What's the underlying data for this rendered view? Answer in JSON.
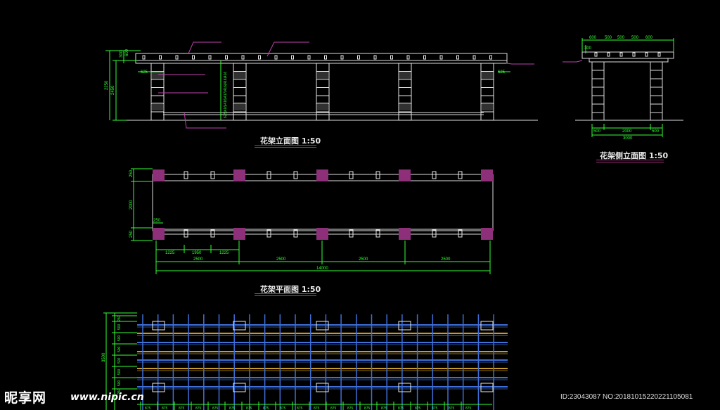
{
  "titles": {
    "front": "花架立面图   1:50",
    "side": "花架侧立面图   1:50",
    "plan": "花架平面图   1:50"
  },
  "front_dims": {
    "left_vertical": [
      "2250",
      "2450",
      "300",
      "600",
      "625"
    ],
    "pillar_stack": "625|416|416|417|416|416|416",
    "right_label": "625"
  },
  "side_dims": {
    "top": [
      "600",
      "500",
      "500",
      "500",
      "600"
    ],
    "bottom_parts": [
      "500",
      "2000",
      "500"
    ],
    "bottom_total": "3000",
    "left": "300"
  },
  "plan_dims": {
    "left_vertical": [
      "250",
      "2000",
      "250"
    ],
    "bottom_parts": [
      "1225",
      "1950",
      "1225"
    ],
    "spans": [
      "2500",
      "2500",
      "2500",
      "2500"
    ],
    "total": "14000",
    "offset": "250"
  },
  "roof_dims": {
    "left_total": "3500",
    "left_parts": [
      "250",
      "500",
      "500",
      "500",
      "500",
      "500",
      "500",
      "250"
    ],
    "bottom_unit": "875"
  },
  "watermark": {
    "logo": "昵享网",
    "url": "www.nipic.cn",
    "id": "ID:23043087 NO:20181015220221105081"
  },
  "colors": {
    "background": "#000000",
    "outline": "#e8e8e8",
    "dimension": "#33ff33",
    "column": "#8e2f7a",
    "beam": "#3f6fd8",
    "purlin": "#c89a2e",
    "annotation": "#b040a0"
  }
}
